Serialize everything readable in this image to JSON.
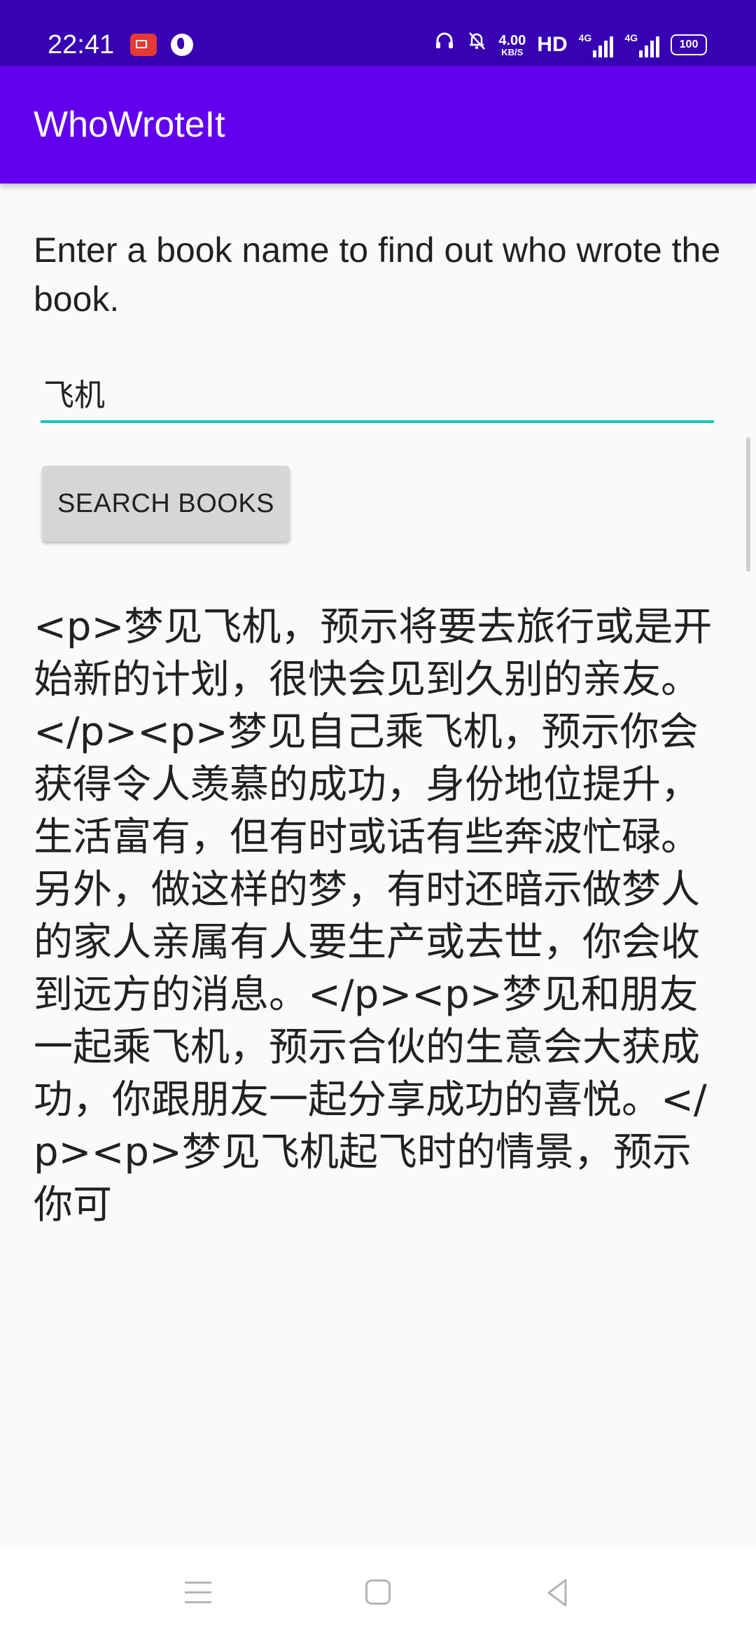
{
  "status_bar": {
    "time": "22:41",
    "speed_value": "4.00",
    "speed_unit": "KB/S",
    "hd_label": "HD",
    "network_1": "4G",
    "network_2": "4G",
    "battery": "100",
    "icons": [
      "screen-record-icon",
      "globe-icon",
      "headphones-icon",
      "mute-bell-icon",
      "signal-icon",
      "battery-icon"
    ]
  },
  "app_bar": {
    "title": "WhoWroteIt",
    "background_color": "#6200ee",
    "status_color": "#3700b3"
  },
  "main": {
    "prompt": "Enter a book name to find out who wrote the book.",
    "search_input_value": "飞机",
    "input_underline_color": "#18c6b5",
    "search_button_label": "SEARCH BOOKS",
    "result_text": "<p>梦见飞机，预示将要去旅行或是开始新的计划，很快会见到久别的亲友。</p><p>梦见自己乘飞机，预示你会获得令人羡慕的成功，身份地位提升，生活富有，但有时或话有些奔波忙碌。另外，做这样的梦，有时还暗示做梦人的家人亲属有人要生产或去世，你会收到远方的消息。</p><p>梦见和朋友一起乘飞机，预示合伙的生意会大获成功，你跟朋友一起分享成功的喜悦。</p><p>梦见飞机起飞时的情景，预示你可"
  },
  "nav_bar": {
    "icons": [
      "menu-icon",
      "home-icon",
      "back-icon"
    ]
  }
}
